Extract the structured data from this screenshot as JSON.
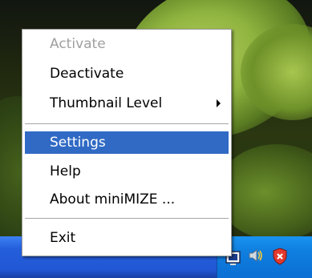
{
  "context_menu": {
    "items": [
      {
        "label": "Activate",
        "enabled": false
      },
      {
        "label": "Deactivate",
        "enabled": true
      },
      {
        "label": "Thumbnail Level",
        "enabled": true,
        "has_submenu": true
      },
      {
        "label": "Settings",
        "enabled": true,
        "highlighted": true
      },
      {
        "label": "Help",
        "enabled": true
      },
      {
        "label": "About miniMIZE ...",
        "enabled": true
      },
      {
        "label": "Exit",
        "enabled": true
      }
    ]
  },
  "tray": {
    "icons": [
      "monitor-icon",
      "speaker-icon",
      "security-shield-icon"
    ]
  },
  "colors": {
    "menu_highlight": "#316ac5",
    "taskbar": "#245edb",
    "tray": "#0f7fe0",
    "disabled_text": "#a0a0a0"
  }
}
